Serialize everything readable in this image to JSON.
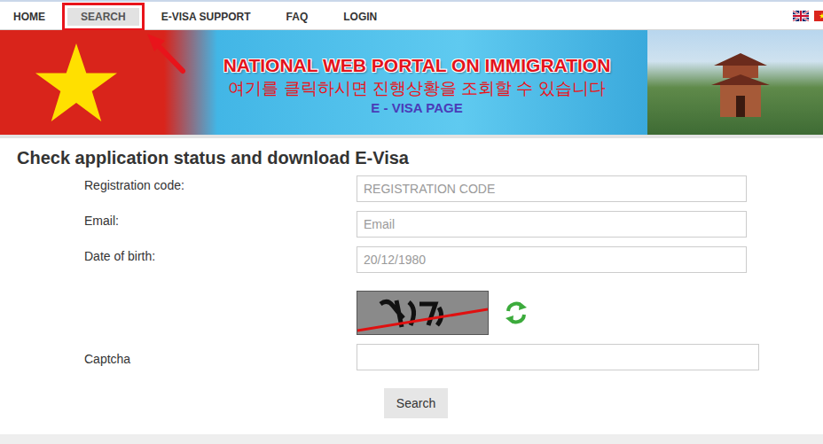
{
  "nav": {
    "items": [
      {
        "label": "HOME",
        "selected": false
      },
      {
        "label": "SEARCH",
        "selected": true
      },
      {
        "label": "E-VISA SUPPORT",
        "selected": false
      },
      {
        "label": "FAQ",
        "selected": false
      },
      {
        "label": "LOGIN",
        "selected": false
      }
    ]
  },
  "banner": {
    "title": "NATIONAL WEB PORTAL ON IMMIGRATION",
    "subtitle": "E - VISA PAGE"
  },
  "annotation": {
    "text": "여기를 클릭하시면 진행상황을 조회할 수 있습니다"
  },
  "form": {
    "title": "Check application status and download E-Visa",
    "fields": [
      {
        "label": "Registration code:",
        "placeholder": "REGISTRATION CODE"
      },
      {
        "label": "Email:",
        "placeholder": "Email"
      },
      {
        "label": "Date of birth:",
        "placeholder": "20/12/1980"
      }
    ],
    "captcha": {
      "label": "Captcha"
    },
    "button": "Search"
  }
}
